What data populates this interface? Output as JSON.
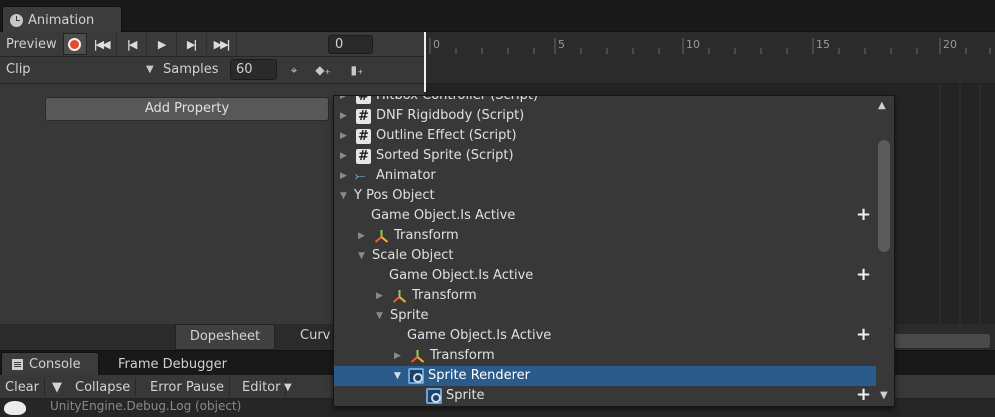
{
  "animation": {
    "tab_title": "Animation",
    "preview_label": "Preview",
    "frame_value": "0",
    "clip_label": "Clip",
    "samples_label": "Samples",
    "samples_value": "60",
    "add_property_label": "Add Property",
    "ruler_ticks": [
      "0",
      "5",
      "10",
      "15",
      "20"
    ],
    "bottom_tabs": [
      "Dopesheet",
      "Curv"
    ],
    "transport_buttons": [
      "first-key",
      "prev-key",
      "play",
      "next-key",
      "last-key"
    ]
  },
  "dropdown": {
    "partial_top_label": "Hitbox Controller (Script)",
    "rows": [
      {
        "label": "DNF Rigidbody (Script)",
        "icon": "script-icon"
      },
      {
        "label": "Outline Effect (Script)",
        "icon": "script-icon"
      },
      {
        "label": "Sorted Sprite (Script)",
        "icon": "script-icon"
      },
      {
        "label": "Animator",
        "icon": "animator-icon"
      },
      {
        "label": "Y Pos Object",
        "icon": ""
      },
      {
        "label": "Game Object.Is Active",
        "icon": ""
      },
      {
        "label": "Transform",
        "icon": "transform-icon"
      },
      {
        "label": "Scale Object",
        "icon": ""
      },
      {
        "label": "Game Object.Is Active",
        "icon": ""
      },
      {
        "label": "Transform",
        "icon": "transform-icon"
      },
      {
        "label": "Sprite",
        "icon": ""
      },
      {
        "label": "Game Object.Is Active",
        "icon": ""
      },
      {
        "label": "Transform",
        "icon": "transform-icon"
      },
      {
        "label": "Sprite Renderer",
        "icon": "sprite-renderer-icon"
      },
      {
        "label": "Sprite",
        "icon": "sprite-renderer-icon"
      }
    ],
    "selected_row": "Sprite Renderer"
  },
  "console": {
    "tab_title": "Console",
    "second_tab": "Frame Debugger",
    "toolbar": [
      "Clear",
      "Collapse",
      "Error Pause",
      "Editor"
    ],
    "log_line": "UnityEngine.Debug.Log (object)"
  },
  "colors": {
    "selection": "#2b5b8a",
    "record": "#e8492d",
    "panel": "#383838"
  }
}
